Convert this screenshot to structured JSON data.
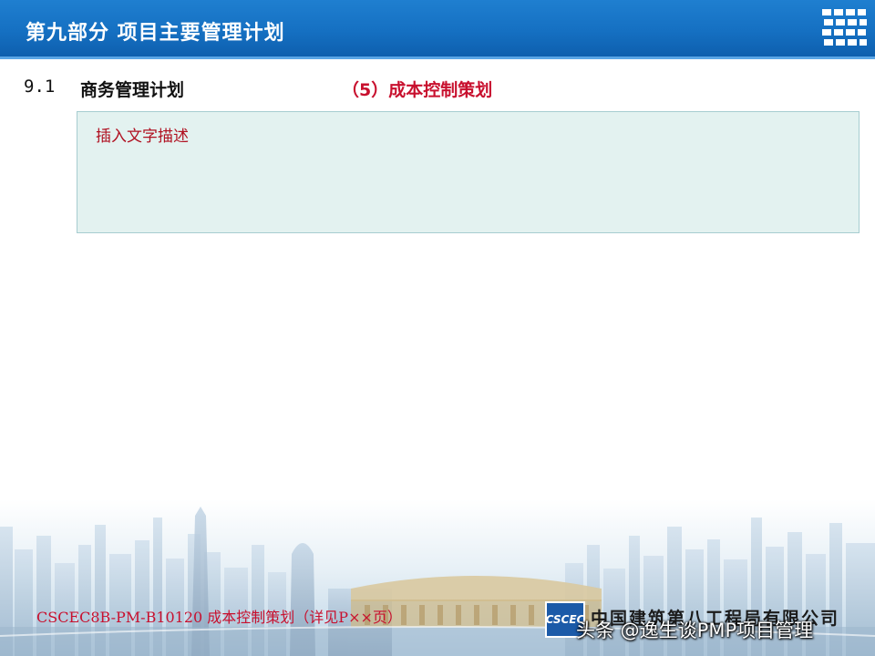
{
  "header": {
    "title": "第九部分   项目主要管理计划"
  },
  "section": {
    "number": "9.1",
    "title": "商务管理计划",
    "subtitle": "（5）成本控制策划"
  },
  "description_box": {
    "text": "插入文字描述"
  },
  "footer": {
    "doc_ref": "CSCEC8B-PM-B10120  成本控制策划（详见P××页）",
    "company_logo_text": "CSCEC",
    "company_name": "中国建筑第八工程局有限公司",
    "watermark": "头条 @逸生谈PMP项目管理"
  },
  "colors": {
    "header_blue": "#1570c2",
    "accent_red": "#c8102e",
    "box_fill": "#e3f2f0"
  }
}
